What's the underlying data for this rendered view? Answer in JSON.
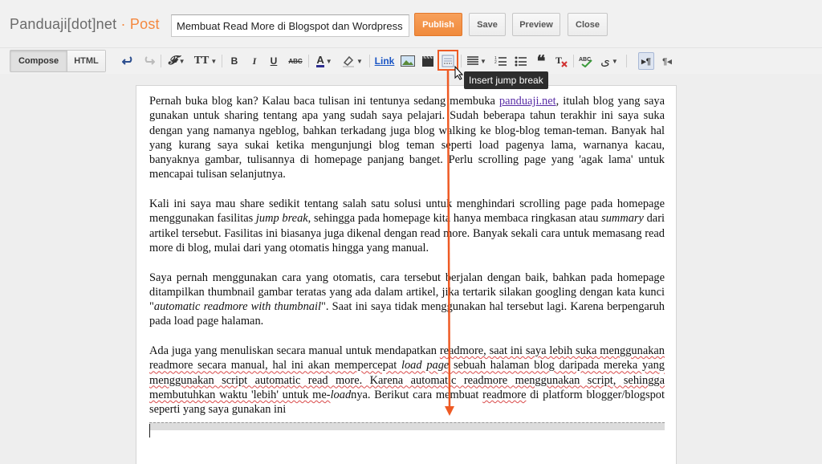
{
  "header": {
    "blog_name": "Panduaji[dot]net",
    "separator": " · ",
    "page_type": "Post",
    "title_value": "Membuat Read More di Blogspot dan Wordpress",
    "publish_label": "Publish",
    "save_label": "Save",
    "preview_label": "Preview",
    "close_label": "Close"
  },
  "toolbar": {
    "compose_label": "Compose",
    "html_label": "HTML",
    "link_label": "Link",
    "tooltip": "Insert jump break",
    "icons": [
      "undo-icon",
      "redo-icon",
      "font-family-icon",
      "font-size-icon",
      "bold-icon",
      "italic-icon",
      "underline-icon",
      "strikethrough-icon",
      "text-color-icon",
      "highlight-color-icon",
      "image-icon",
      "video-icon",
      "jump-break-icon",
      "alignment-icon",
      "numbered-list-icon",
      "bulleted-list-icon",
      "quote-icon",
      "remove-formatting-icon",
      "spell-check-icon",
      "input-tools-icon",
      "ltr-icon",
      "rtl-icon"
    ]
  },
  "body": {
    "p1": {
      "a": "Pernah buka blog kan? Kalau baca tulisan ini tentunya sedang membuka ",
      "link": "panduaji.net",
      "b": ", itulah blog yang saya gunakan untuk sharing tentang apa yang sudah saya pelajari. Sudah beberapa tahun terakhir ini saya suka dengan yang namanya ngeblog, bahkan terkadang juga blog walking ke blog-blog teman-teman. Banyak hal yang kurang saya sukai ketika mengunjungi blog teman seperti load pagenya lama, warnanya kacau, banyaknya gambar, tulisannya di homepage panjang banget. Perlu scrolling page yang 'agak lama' untuk mencapai tulisan selanjutnya."
    },
    "p2": {
      "a": "Kali ini saya mau share sedikit tentang salah satu solusi untuk menghindari scrolling page pada homepage menggunakan fasilitas ",
      "i1": "jump break",
      "b": ", sehingga pada homepage kita hanya membaca ringkasan atau ",
      "i2": "summary",
      "c": " dari artikel tersebut. Fasilitas ini biasanya juga dikenal dengan read more. Banyak sekali cara untuk memasang read more di blog, mulai dari yang otomatis hingga yang manual."
    },
    "p3": {
      "a": "Saya pernah menggunakan cara yang otomatis, cara tersebut berjalan dengan baik, bahkan pada homepage ditampilkan thumbnail gambar teratas yang ada dalam artikel, jika tertarik silakan googling dengan kata kunci \"",
      "i1": "automatic readmore with thumbnail",
      "b": "\". Saat ini saya tidak menggunakan hal tersebut lagi. Karena berpengaruh pada load page halaman."
    },
    "p4": {
      "a": "Ada juga yang menuliskan secara manual untuk mendapatkan ",
      "u1": "readmore, saat ini saya lebih suka menggunakan readmore secara manual, hal ini akan mempercepat",
      "i1": " load page",
      "u2": " sebuah halaman blog daripada mereka yang menggunakan script automatic read more. Karena automatic readmore menggunakan script, sehingga membutuhkan waktu 'lebih' untuk me-",
      "i2": "load",
      "c": "nya. Berikut cara membuat ",
      "u3": "readmore",
      "d": " di platform blogger/blogspot seperti yang saya gunakan ini"
    }
  },
  "colors": {
    "accent": "#f4883f",
    "annotation": "#ee5a24",
    "link": "#5a2ea6"
  }
}
